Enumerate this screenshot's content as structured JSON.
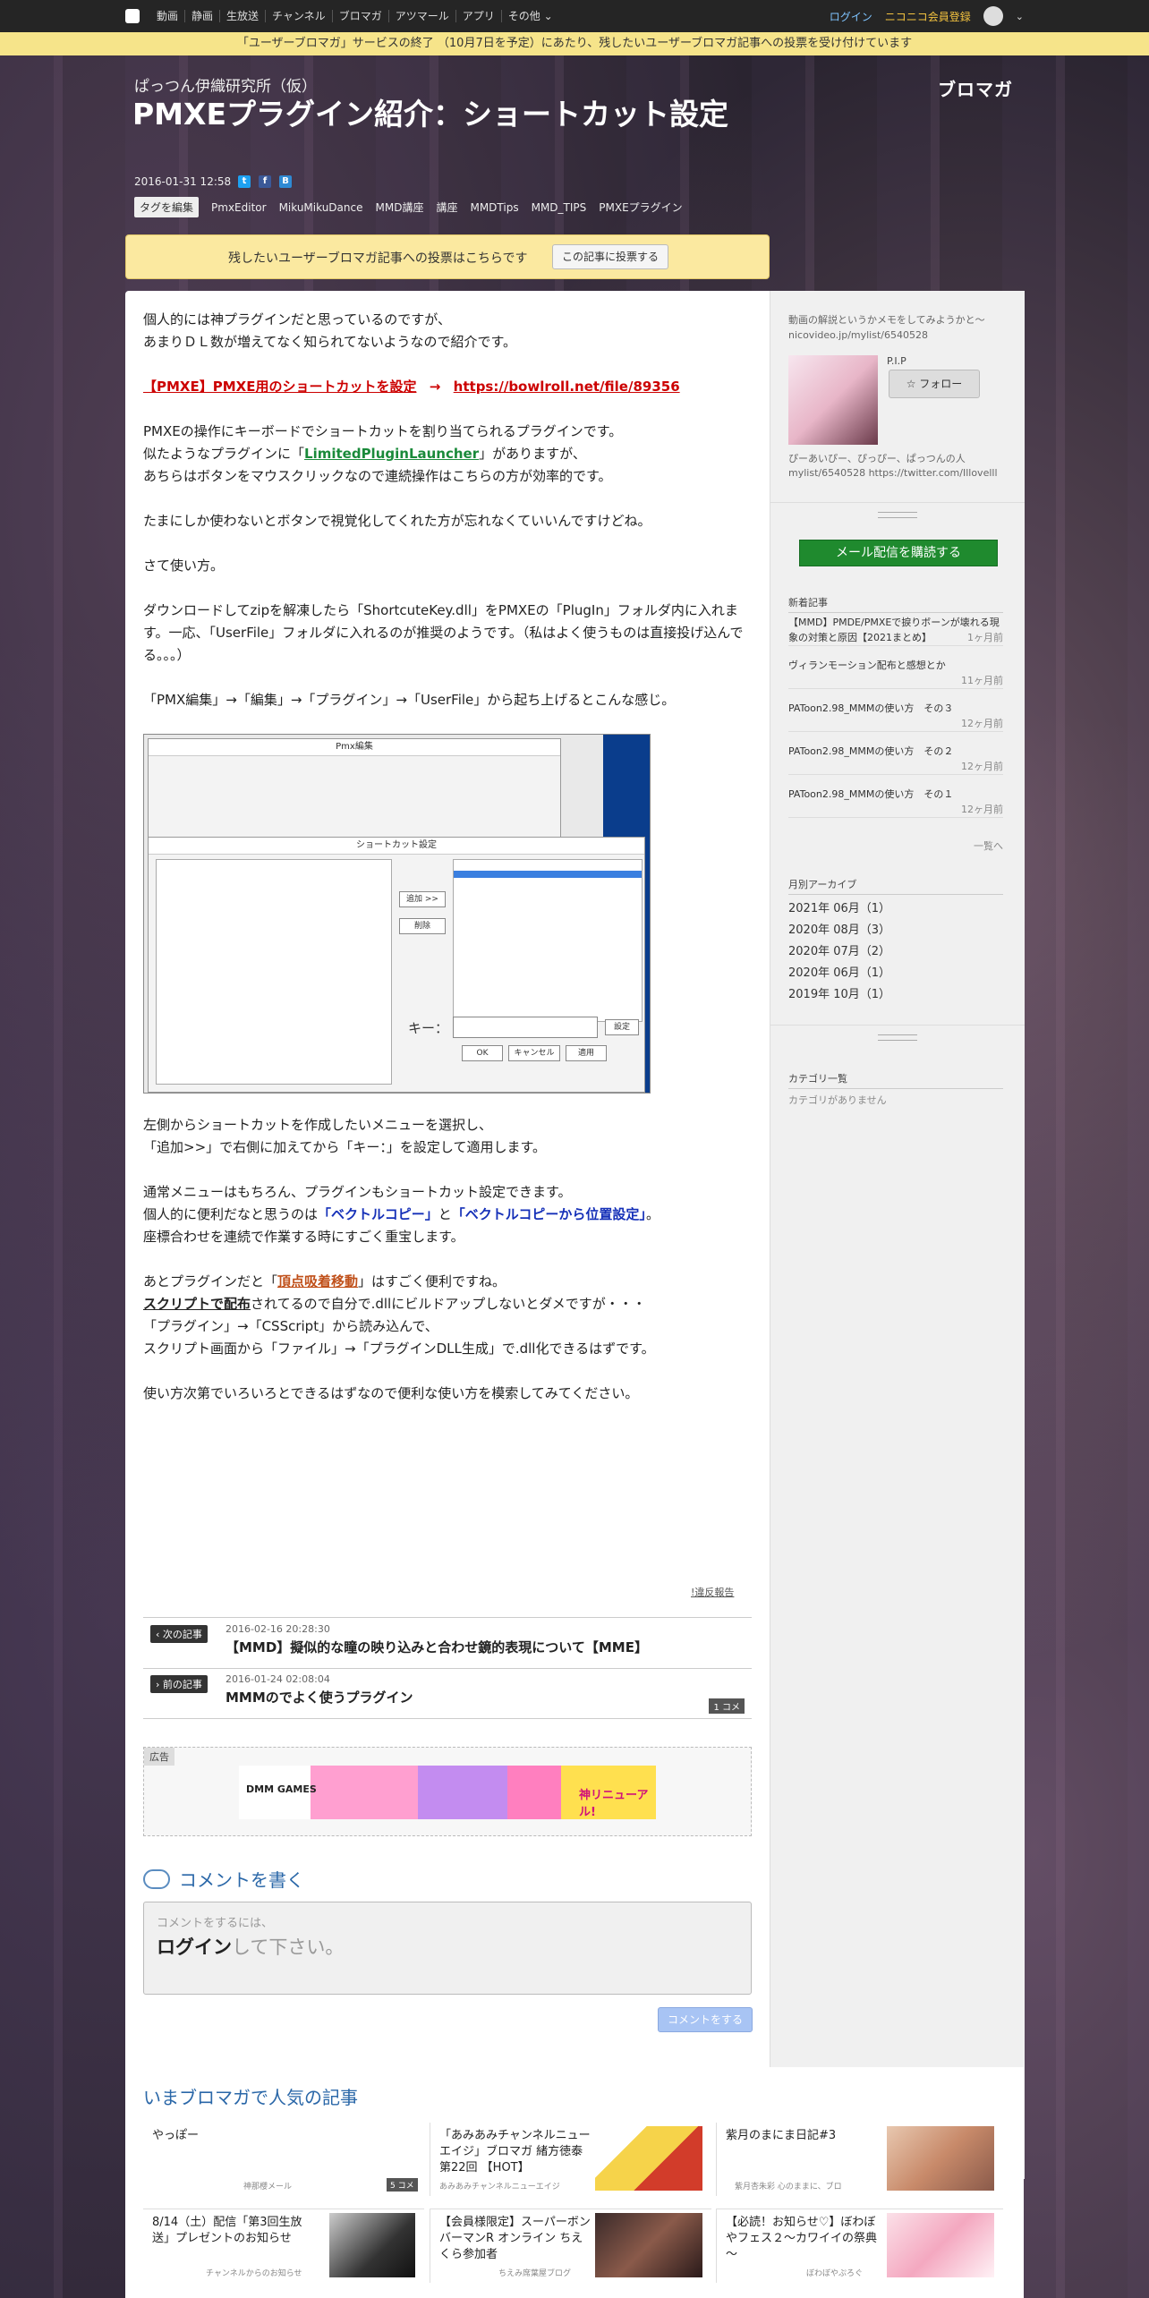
{
  "topnav": {
    "links": [
      "動画",
      "静画",
      "生放送",
      "チャンネル",
      "ブロマガ",
      "アツマール",
      "アプリ",
      "その他"
    ],
    "login": "ログイン",
    "register": "ニコニコ会員登録"
  },
  "notice": "「ユーザーブロマガ」サービスの終了 （10月7日を予定）にあたり、残したいユーザーブロマガ記事への投票を受け付けています",
  "header": {
    "blog_name": "ぱっつん伊織研究所（仮）",
    "brand": "ブロマガ",
    "title": "PMXEプラグイン紹介：ショートカット設定",
    "date": "2016-01-31 12:58",
    "tag_edit": "タグを編集",
    "tags": [
      "PmxEditor",
      "MikuMikuDance",
      "MMD講座",
      "講座",
      "MMDTips",
      "MMD_TIPS",
      "PMXEプラグイン"
    ]
  },
  "vote": {
    "text": "残したいユーザーブロマガ記事への投票はこちらです",
    "button": "この記事に投票する"
  },
  "article": {
    "p1a": "個人的には神プラグインだと思っているのですが、",
    "p1b": "あまりＤＬ数が増えてなく知られてないようなので紹介です。",
    "link_text": "【PMXE】PMXE用のショートカットを設定",
    "arrow": "→",
    "link_url": "https://bowlroll.net/file/89356",
    "p3a": "PMXEの操作にキーボードでショートカットを割り当てられるプラグインです。",
    "p3b_pre": "似たようなプラグインに「",
    "p3b_link": "LimitedPluginLauncher",
    "p3b_post": "」がありますが、",
    "p3c": "あちらはボタンをマウスクリックなので連続操作はこちらの方が効率的です。",
    "p4": "たまにしか使わないとボタンで視覚化してくれた方が忘れなくていいんですけどね。",
    "p5": "さて使い方。",
    "p6": "ダウンロードしてzipを解凍したら「ShortcuteKey.dll」をPMXEの「PlugIn」フォルダ内に入れます。一応、「UserFile」フォルダに入れるのが推奨のようです。（私はよく使うものは直接投げ込んでる。。。）",
    "p7": "「PMX編集」→「編集」→「プラグイン」→「UserFile」から起ち上げるとこんな感じ。",
    "p8a": "左側からショートカットを作成したいメニューを選択し、",
    "p8b": "「追加>>」で右側に加えてから「キー：」を設定して適用します。",
    "p9a": "通常メニューはもちろん、プラグインもショートカット設定できます。",
    "p9b_pre": "個人的に便利だなと思うのは",
    "p9b_b1": "「ベクトルコピー」",
    "p9b_mid": "と",
    "p9b_b2": "「ベクトルコピーから位置設定」",
    "p9b_post": "。",
    "p9c": "座標合わせを連続で作業する時にすごく重宝します。",
    "p10a_pre": "あとプラグインだと「",
    "p10a_link": "頂点吸着移動",
    "p10a_post": "」はすごく便利ですね。",
    "p10b_link": "スクリプトで配布",
    "p10b_post": "されてるので自分で.dllにビルドアップしないとダメですが・・・",
    "p10c": "「プラグイン」→「CSScript」から読み込んで、",
    "p10d": "スクリプト画面から「ファイル」→「プラグインDLL生成」で.dll化できるはずです。",
    "p11": "使い方次第でいろいろとできるはずなので便利な使い方を模索してみてください。"
  },
  "screenshot": {
    "win1_title": "Pmx編集",
    "win2_title": "ショートカット設定",
    "add": "追加 >>",
    "del": "削除",
    "key": "キー：",
    "apply_set": "設定",
    "ok": "OK",
    "cancel": "キャンセル",
    "apply": "適用"
  },
  "report": "!違反報告",
  "next": {
    "label": "次の記事",
    "date": "2016-02-16 20:28:30",
    "title": "【MMD】擬似的な瞳の映り込みと合わせ鏡的表現について【MME】"
  },
  "prev": {
    "label": "前の記事",
    "date": "2016-01-24 02:08:04",
    "title": "MMMのでよく使うプラグイン",
    "comments": "1 コメ"
  },
  "ad": {
    "label": "広告",
    "brand": "DMM GAMES",
    "catch": "神リニューアル!"
  },
  "comment": {
    "heading": "コメントを書く",
    "hint": "コメントをするには、",
    "login": "ログイン",
    "login_post": "して下さい。",
    "submit": "コメントをする"
  },
  "sidebar": {
    "description": "動画の解説というかメモをしてみようかと～ nicovideo.jp/mylist/6540528",
    "profile_name": "P.I.P",
    "follow": "フォロー",
    "profile_desc": "ぴーあいぴー、ぴっぴー、ぱっつんの人 mylist/6540528 https://twitter.com/Illovelll",
    "mail": "メール配信を購読する",
    "recent_heading": "新着記事",
    "recent": [
      {
        "title": "【MMD】PMDE/PMXEで捩りボーンが壊れる現象の対策と原因【2021まとめ】",
        "ago": "1ヶ月前"
      },
      {
        "title": "ヴィランモーション配布と感想とか",
        "ago": "11ヶ月前"
      },
      {
        "title": "PAToon2.98_MMMの使い方　その３",
        "ago": "12ヶ月前"
      },
      {
        "title": "PAToon2.98_MMMの使い方　その２",
        "ago": "12ヶ月前"
      },
      {
        "title": "PAToon2.98_MMMの使い方　その１",
        "ago": "12ヶ月前"
      }
    ],
    "more": "一覧へ",
    "archive_heading": "月別アーカイブ",
    "archive": [
      "2021年 06月（1）",
      "2020年 08月（3）",
      "2020年 07月（2）",
      "2020年 06月（1）",
      "2019年 10月（1）"
    ],
    "category_heading": "カテゴリ一覧",
    "category_none": "カテゴリがありません"
  },
  "popular": {
    "heading": "いまブロマガで人気の記事",
    "items": [
      {
        "title": "やっぽー",
        "source": "神那櫻メール",
        "comments": "5 コメ"
      },
      {
        "title": "「あみあみチャンネルニューエイジ」ブロマガ 緒方徳泰 第22回 【HOT】",
        "source": "あみあみチャンネルニューエイジ"
      },
      {
        "title": "紫月のまにま日記#3",
        "source": "紫月杏朱彩 心のままに、ブロ"
      },
      {
        "title": "8/14（土）配信「第3回生放送」プレゼントのお知らせ",
        "source": "チャンネルからのお知らせ"
      },
      {
        "title": "【会員様限定】スーパーボンバーマンR オンライン ちえくら参加者",
        "source": "ちえみ席葉屋ブログ"
      },
      {
        "title": "【必読！お知らせ♡】ぼわぼやフェス２～カワイイの祭典～",
        "source": "ぼわぼやぷろぐ"
      }
    ]
  },
  "colors": {
    "accent_link": "#2a67a8",
    "notice_bg": "#f6e48a",
    "mail_green": "#1f8a2e"
  }
}
